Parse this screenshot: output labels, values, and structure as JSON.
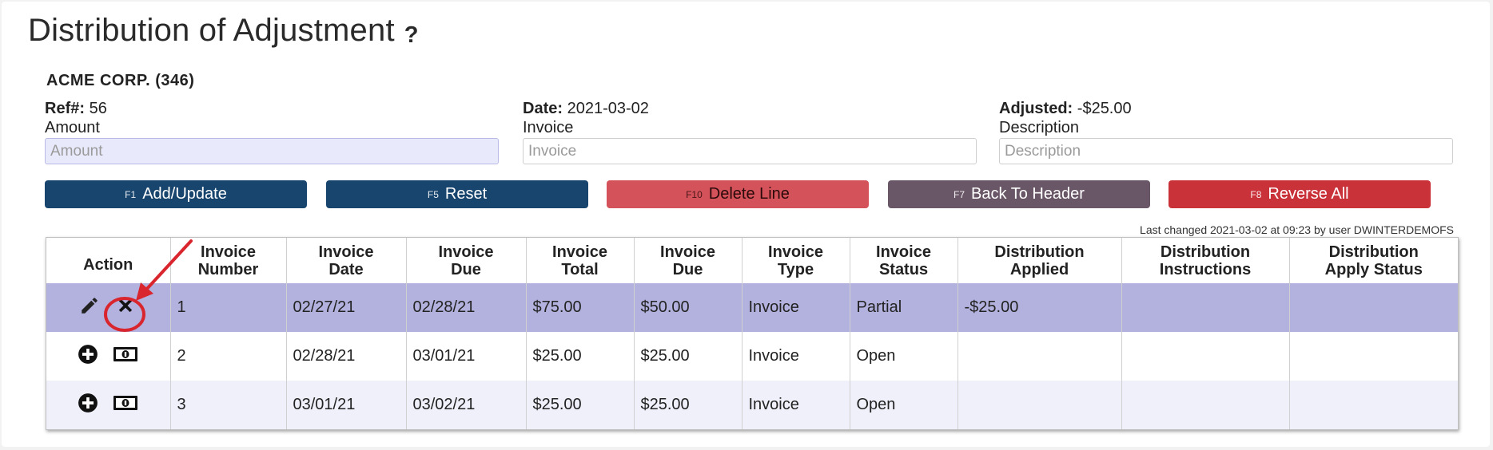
{
  "page": {
    "title": "Distribution of Adjustment",
    "help_icon_glyph": "?",
    "company": "ACME CORP. (346)"
  },
  "meta": {
    "ref_label": "Ref#:",
    "ref_value": "56",
    "date_label": "Date:",
    "date_value": "2021-03-02",
    "adjusted_label": "Adjusted:",
    "adjusted_value": "-$25.00"
  },
  "fields": {
    "amount": {
      "label": "Amount",
      "placeholder": "Amount",
      "value": ""
    },
    "invoice": {
      "label": "Invoice",
      "placeholder": "Invoice",
      "value": ""
    },
    "description": {
      "label": "Description",
      "placeholder": "Description",
      "value": ""
    }
  },
  "buttons": {
    "add_update": {
      "key": "F1",
      "label": "Add/Update"
    },
    "reset": {
      "key": "F5",
      "label": "Reset"
    },
    "delete_line": {
      "key": "F10",
      "label": "Delete Line"
    },
    "back_to_header": {
      "key": "F7",
      "label": "Back To Header"
    },
    "reverse_all": {
      "key": "F8",
      "label": "Reverse All"
    }
  },
  "last_changed": "Last changed 2021-03-02 at 09:23 by user DWINTERDEMOFS",
  "table": {
    "headers": {
      "action": "Action",
      "invoice_number": [
        "Invoice",
        "Number"
      ],
      "invoice_date": [
        "Invoice",
        "Date"
      ],
      "invoice_due_date": [
        "Invoice",
        "Due"
      ],
      "invoice_total": [
        "Invoice",
        "Total"
      ],
      "invoice_due_amount": [
        "Invoice",
        "Due"
      ],
      "invoice_type": [
        "Invoice",
        "Type"
      ],
      "invoice_status": [
        "Invoice",
        "Status"
      ],
      "distribution_applied": [
        "Distribution",
        "Applied"
      ],
      "distribution_instructions": [
        "Distribution",
        "Instructions"
      ],
      "distribution_apply_status": [
        "Distribution",
        "Apply Status"
      ]
    },
    "rows": [
      {
        "actions": [
          "pencil-icon",
          "remove-icon"
        ],
        "number": "1",
        "date": "02/27/21",
        "due_date": "02/28/21",
        "total": "$75.00",
        "due": "$50.00",
        "type": "Invoice",
        "status": "Partial",
        "applied": "-$25.00",
        "instructions": "",
        "apply_status": ""
      },
      {
        "actions": [
          "plus-icon",
          "money-icon"
        ],
        "number": "2",
        "date": "02/28/21",
        "due_date": "03/01/21",
        "total": "$25.00",
        "due": "$25.00",
        "type": "Invoice",
        "status": "Open",
        "applied": "",
        "instructions": "",
        "apply_status": ""
      },
      {
        "actions": [
          "plus-icon",
          "money-icon"
        ],
        "number": "3",
        "date": "03/01/21",
        "due_date": "03/02/21",
        "total": "$25.00",
        "due": "$25.00",
        "type": "Invoice",
        "status": "Open",
        "applied": "",
        "instructions": "",
        "apply_status": ""
      }
    ]
  },
  "colors": {
    "selected_row": "#b3b2de",
    "alt_row": "#eff0fa",
    "annotation": "#d9262e",
    "btn_blue": "#17456e",
    "btn_salmon": "#d4525a",
    "btn_mauve": "#695666",
    "btn_red": "#ca3239"
  }
}
